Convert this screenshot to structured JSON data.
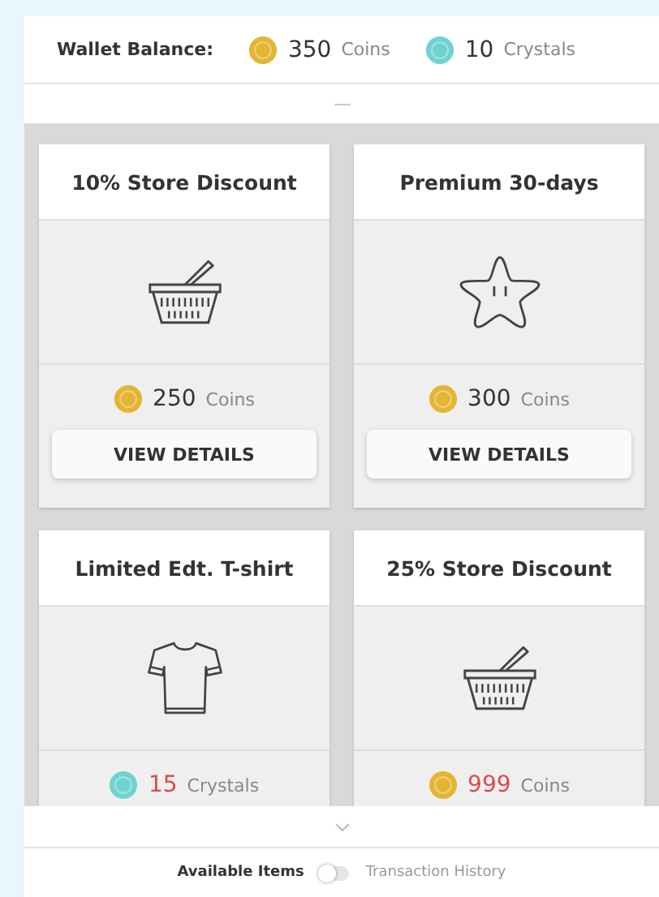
{
  "wallet": {
    "label": "Wallet Balance:",
    "balances": [
      {
        "kind": "coin",
        "amount": "350",
        "unit": "Coins"
      },
      {
        "kind": "crystal",
        "amount": "10",
        "unit": "Crystals"
      }
    ]
  },
  "items": [
    {
      "title": "10% Store Discount",
      "kind": "basket",
      "price": {
        "kind": "coin",
        "amount": "250",
        "unit": "Coins"
      },
      "affordable": true,
      "button": "VIEW DETAILS"
    },
    {
      "title": "Premium 30-days",
      "kind": "star",
      "price": {
        "kind": "coin",
        "amount": "300",
        "unit": "Coins"
      },
      "affordable": true,
      "button": "VIEW DETAILS"
    },
    {
      "title": "Limited Edt. T-shirt",
      "kind": "tshirt",
      "price": {
        "kind": "crystal",
        "amount": "15",
        "unit": "Crystals"
      },
      "affordable": false
    },
    {
      "title": "25% Store Discount",
      "kind": "basket",
      "price": {
        "kind": "coin",
        "amount": "999",
        "unit": "Coins"
      },
      "affordable": false
    }
  ],
  "view_switch": {
    "left": "Available Items",
    "right": "Transaction History",
    "on": false
  }
}
